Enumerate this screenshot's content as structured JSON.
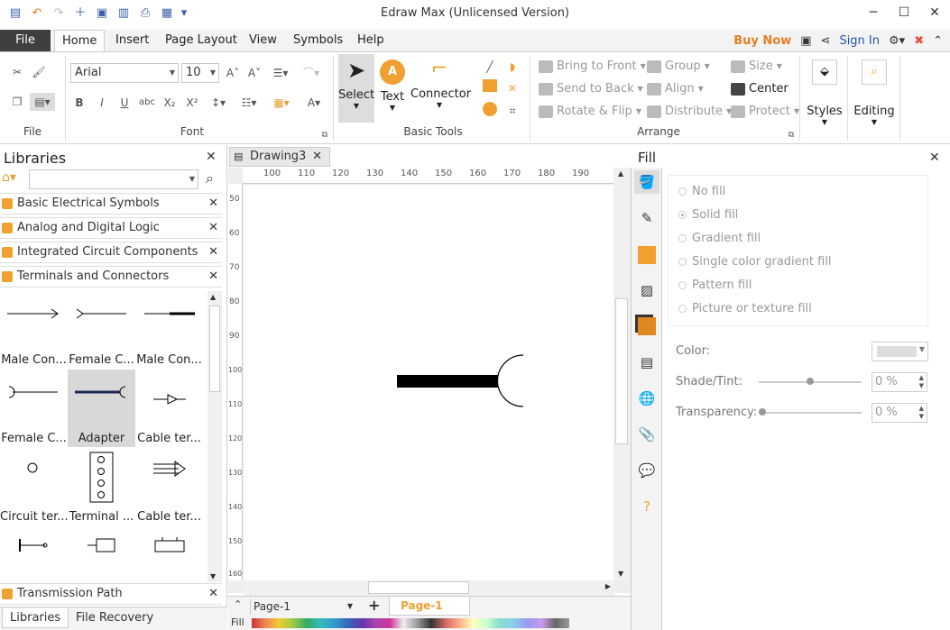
{
  "window": {
    "title": "Edraw Max (Unlicensed Version)"
  },
  "menu": {
    "file": "File",
    "tabs": [
      "Home",
      "Insert",
      "Page Layout",
      "View",
      "Symbols",
      "Help"
    ],
    "buy_now": "Buy Now",
    "sign_in": "Sign In"
  },
  "ribbon": {
    "file_group": "File",
    "font_group": "Font",
    "font_name": "Arial",
    "font_size": "10",
    "basic_tools_group": "Basic Tools",
    "select": "Select",
    "text": "Text",
    "connector": "Connector",
    "arrange_group": "Arrange",
    "bring_to_front": "Bring to Front",
    "send_to_back": "Send to Back",
    "rotate_flip": "Rotate & Flip",
    "group": "Group",
    "align": "Align",
    "distribute": "Distribute",
    "size": "Size",
    "center": "Center",
    "protect": "Protect",
    "styles": "Styles",
    "editing": "Editing"
  },
  "libraries": {
    "title": "Libraries",
    "items": [
      "Basic Electrical Symbols",
      "Analog and Digital Logic",
      "Integrated Circuit Components",
      "Terminals and Connectors"
    ],
    "shapes": [
      "Male Con...",
      "Female C...",
      "Male Con...",
      "Female C...",
      "Adapter",
      "Cable ter...",
      "Circuit ter...",
      "Terminal ...",
      "Cable ter..."
    ],
    "bottom_item": "Transmission Path",
    "tab_libraries": "Libraries",
    "tab_recovery": "File Recovery"
  },
  "document": {
    "tab": "Drawing3",
    "page_selector": "Page-1",
    "page_tab": "Page-1",
    "fill_label": "Fill",
    "hruler": [
      "100",
      "110",
      "120",
      "130",
      "140",
      "150",
      "160",
      "170",
      "180",
      "190"
    ],
    "vruler": [
      "50",
      "60",
      "70",
      "80",
      "90",
      "100",
      "110",
      "120",
      "130",
      "140",
      "150",
      "160"
    ]
  },
  "fill": {
    "title": "Fill",
    "options": [
      "No fill",
      "Solid fill",
      "Gradient fill",
      "Single color gradient fill",
      "Pattern fill",
      "Picture or texture fill"
    ],
    "color_label": "Color:",
    "shade_label": "Shade/Tint:",
    "shade_value": "0 %",
    "transparency_label": "Transparency:",
    "transparency_value": "0 %"
  },
  "colors": {
    "accent": "#f0a030",
    "file_bg": "#3f3f3f",
    "buy_now": "#e67e22"
  }
}
